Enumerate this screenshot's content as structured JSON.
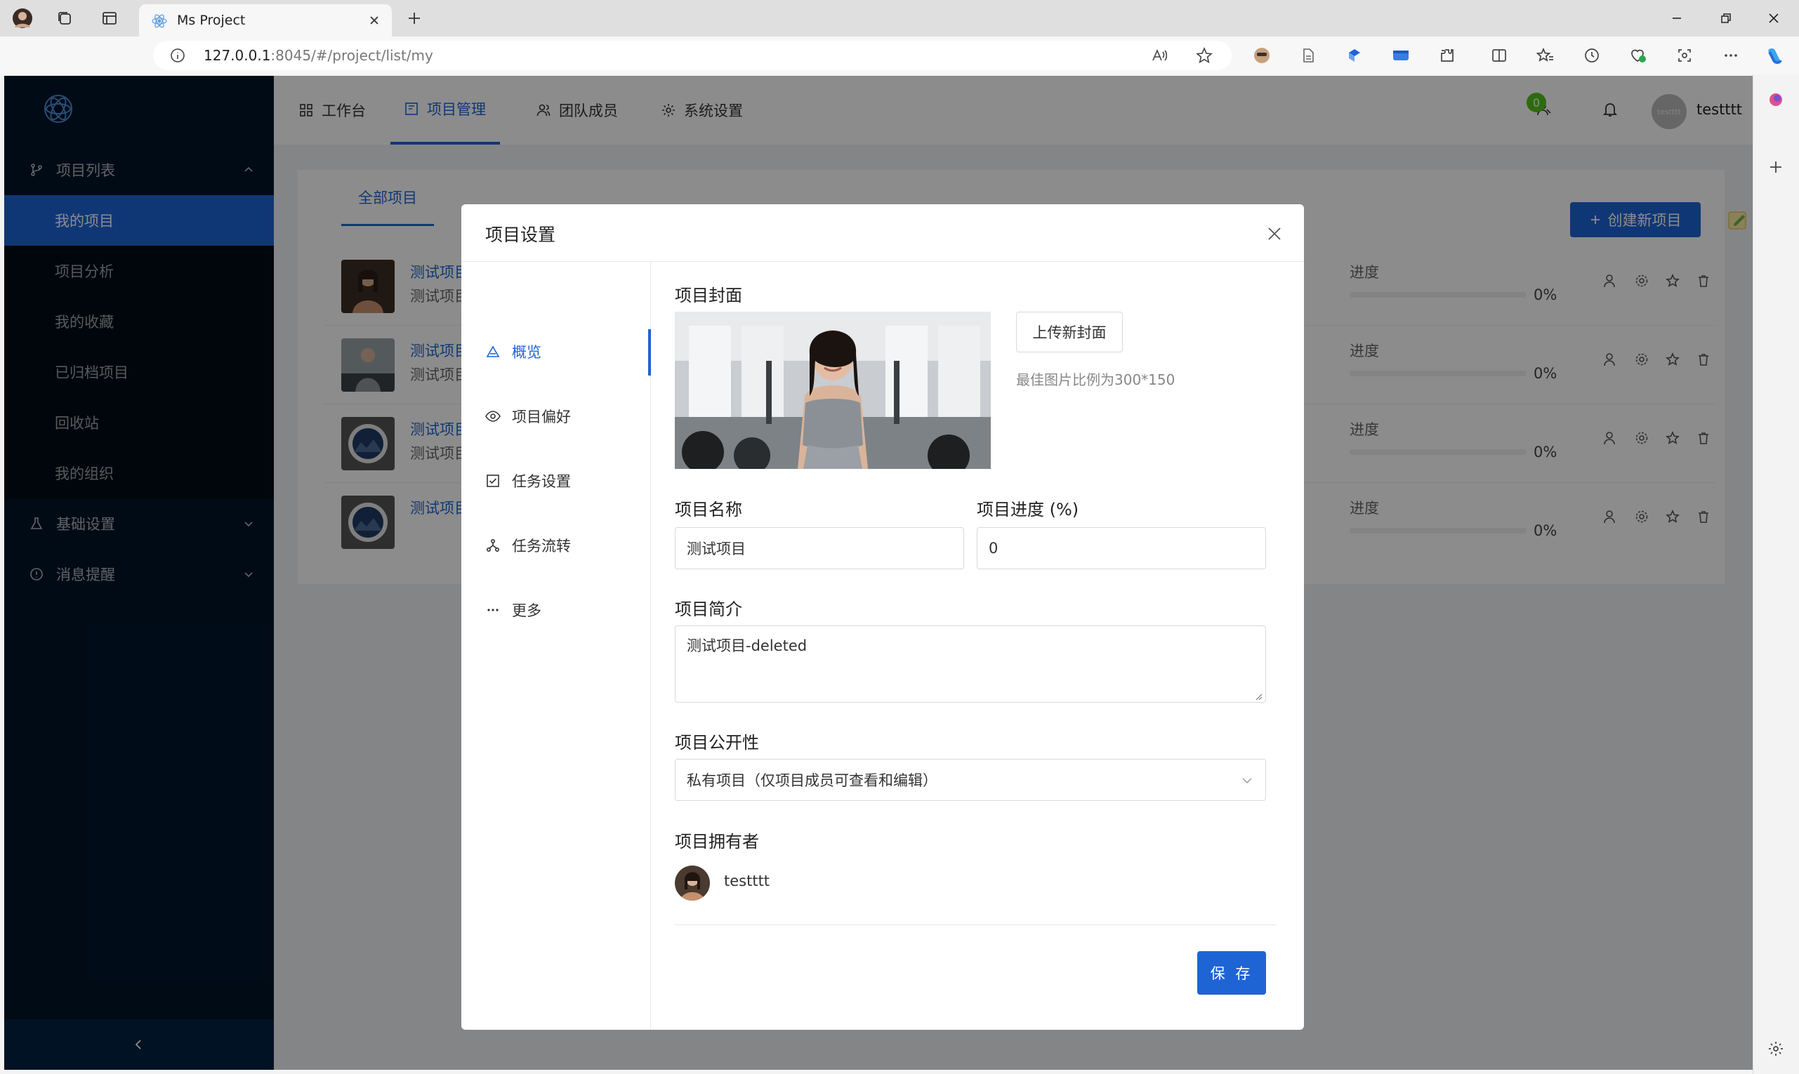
{
  "browser": {
    "tab_title": "Ms Project",
    "url_host": "127.0.0.1",
    "url_path": ":8045/#/project/list/my"
  },
  "sidebar": {
    "groups": [
      {
        "label": "项目列表",
        "icon": "branch-icon"
      },
      {
        "label": "基础设置",
        "icon": "flask-icon"
      },
      {
        "label": "消息提醒",
        "icon": "info-circle-icon"
      }
    ],
    "items": [
      {
        "label": "我的项目",
        "active": true
      },
      {
        "label": "项目分析"
      },
      {
        "label": "我的收藏"
      },
      {
        "label": "已归档项目"
      },
      {
        "label": "回收站"
      },
      {
        "label": "我的组织"
      }
    ]
  },
  "topnav": {
    "items": [
      {
        "label": "工作台",
        "icon": "grid-icon"
      },
      {
        "label": "项目管理",
        "icon": "project-icon",
        "active": true
      },
      {
        "label": "团队成员",
        "icon": "team-icon"
      },
      {
        "label": "系统设置",
        "icon": "gear-icon"
      }
    ],
    "member_badge": "0",
    "avatar_text": "testttt",
    "username": "testttt"
  },
  "content": {
    "tab_all": "全部项目",
    "create_button": "创建新项目",
    "progress_label": "进度",
    "projects": [
      {
        "name": "测试项目",
        "desc": "测试项目",
        "progress_text": "0%",
        "progress": 0
      },
      {
        "name": "测试项目",
        "desc": "测试项目-",
        "progress_text": "0%",
        "progress": 0
      },
      {
        "name": "测试项目",
        "desc": "测试项目",
        "progress_text": "0%",
        "progress": 0
      },
      {
        "name": "测试项目2",
        "desc": "",
        "progress_text": "0%",
        "progress": 0
      }
    ]
  },
  "modal": {
    "title": "项目设置",
    "nav": [
      {
        "label": "概览",
        "icon": "warning-triangle-icon",
        "active": true
      },
      {
        "label": "项目偏好",
        "icon": "eye-icon"
      },
      {
        "label": "任务设置",
        "icon": "checkbox-icon"
      },
      {
        "label": "任务流转",
        "icon": "flow-icon"
      },
      {
        "label": "更多",
        "icon": "ellipsis-icon"
      }
    ],
    "cover_label": "项目封面",
    "upload_button": "上传新封面",
    "cover_hint": "最佳图片比例为300*150",
    "name_label": "项目名称",
    "name_value": "测试项目",
    "progress_label": "项目进度 (%)",
    "progress_value": "0",
    "desc_label": "项目简介",
    "desc_value": "测试项目-deleted",
    "visibility_label": "项目公开性",
    "visibility_value": "私有项目（仅项目成员可查看和编辑）",
    "owner_label": "项目拥有者",
    "owner_name": "testttt",
    "save_button": "保 存"
  },
  "colors": {
    "accent": "#1e64d5",
    "sidebar_bg": "#001529",
    "badge_green": "#52c41a"
  }
}
